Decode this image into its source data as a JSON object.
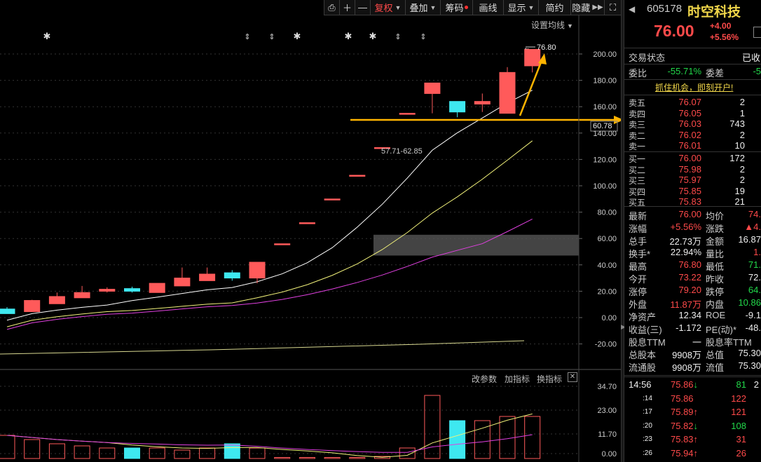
{
  "toolbar": {
    "fuquan": "复权",
    "diejia": "叠加",
    "chouma": "筹码",
    "huaxian": "画线",
    "xianshi": "显示",
    "jianyue": "简约",
    "yincang": "隐藏"
  },
  "chart": {
    "ma_settings": "设置均线",
    "price_ticks": [
      "200.00",
      "180.00",
      "160.00",
      "140.00",
      "120.00",
      "100.00",
      "80.00",
      "60.00",
      "40.00",
      "20.00",
      "0.00",
      "-20.00"
    ],
    "current_price_tag": "60.78",
    "high_annotation": "76.80",
    "gap_annotation": "57.71-62.85",
    "volume_ticks": [
      "34.70",
      "23.00",
      "11.70",
      "0.00"
    ],
    "volume_menu": {
      "change_params": "改参数",
      "add_indicator": "加指标",
      "switch_indicator": "换指标",
      "close": "✕"
    },
    "colors": {
      "up": "#ff5a5a",
      "down": "#3ee8f0",
      "ma1": "#ffffff",
      "ma2": "#f2f27a",
      "ma3": "#e040e0",
      "ma4": "#d8d890",
      "arrow": "#ffb400"
    }
  },
  "chart_data": {
    "type": "candlestick",
    "y_axis_range": [
      -20,
      200
    ],
    "candles": [
      {
        "open": 6.5,
        "high": 8.0,
        "low": 3.0,
        "close": 3.0,
        "dir": "down"
      },
      {
        "open": 4.5,
        "high": 13.5,
        "low": 4.5,
        "close": 13.0,
        "dir": "up"
      },
      {
        "open": 10.5,
        "high": 19.0,
        "low": 10.5,
        "close": 16.0,
        "dir": "up"
      },
      {
        "open": 15.0,
        "high": 24.0,
        "low": 15.0,
        "close": 19.0,
        "dir": "up"
      },
      {
        "open": 20.0,
        "high": 23.0,
        "low": 19.0,
        "close": 21.5,
        "dir": "up"
      },
      {
        "open": 22.0,
        "high": 23.5,
        "low": 19.0,
        "close": 20.0,
        "dir": "down"
      },
      {
        "open": 19.0,
        "high": 26.0,
        "low": 19.0,
        "close": 26.0,
        "dir": "up"
      },
      {
        "open": 24.0,
        "high": 38.0,
        "low": 24.0,
        "close": 30.0,
        "dir": "up"
      },
      {
        "open": 28.0,
        "high": 38.0,
        "low": 28.0,
        "close": 33.0,
        "dir": "up"
      },
      {
        "open": 34.0,
        "high": 36.0,
        "low": 28.0,
        "close": 30.0,
        "dir": "down"
      },
      {
        "open": 30.0,
        "high": 42.0,
        "low": 26.0,
        "close": 42.0,
        "dir": "up"
      },
      {
        "open": 56.0,
        "high": 56.0,
        "low": 56.0,
        "close": 56.0,
        "dir": "up"
      },
      {
        "open": 72.0,
        "high": 72.0,
        "low": 72.0,
        "close": 72.0,
        "dir": "up"
      },
      {
        "open": 90.0,
        "high": 90.0,
        "low": 90.0,
        "close": 90.0,
        "dir": "up"
      },
      {
        "open": 108.0,
        "high": 108.0,
        "low": 108.0,
        "close": 108.0,
        "dir": "up"
      },
      {
        "open": 129.0,
        "high": 129.0,
        "low": 129.0,
        "close": 129.0,
        "dir": "up"
      },
      {
        "open": 155.0,
        "high": 155.0,
        "low": 155.0,
        "close": 155.0,
        "dir": "up"
      },
      {
        "open": 170.0,
        "high": 178.0,
        "low": 155.0,
        "close": 178.0,
        "dir": "up"
      },
      {
        "open": 164.0,
        "high": 164.0,
        "low": 152.0,
        "close": 156.0,
        "dir": "down"
      },
      {
        "open": 162.0,
        "high": 170.0,
        "low": 156.0,
        "close": 164.0,
        "dir": "up"
      },
      {
        "open": 155.0,
        "high": 190.0,
        "low": 155.0,
        "close": 186.0,
        "dir": "up"
      },
      {
        "open": 191.0,
        "high": 203.5,
        "low": 186.0,
        "close": 203.5,
        "dir": "up"
      }
    ],
    "volume": [
      {
        "v": 11.0,
        "dir": "up"
      },
      {
        "v": 9.0,
        "dir": "up"
      },
      {
        "v": 7.0,
        "dir": "up"
      },
      {
        "v": 6.0,
        "dir": "up"
      },
      {
        "v": 5.0,
        "dir": "up"
      },
      {
        "v": 5.0,
        "dir": "down"
      },
      {
        "v": 5.0,
        "dir": "up"
      },
      {
        "v": 4.0,
        "dir": "up"
      },
      {
        "v": 5.0,
        "dir": "up"
      },
      {
        "v": 7.0,
        "dir": "down"
      },
      {
        "v": 5.0,
        "dir": "up"
      },
      {
        "v": 0.5,
        "dir": "up"
      },
      {
        "v": 0.5,
        "dir": "up"
      },
      {
        "v": 0.5,
        "dir": "up"
      },
      {
        "v": 0.5,
        "dir": "up"
      },
      {
        "v": 1.0,
        "dir": "up"
      },
      {
        "v": 5.0,
        "dir": "up"
      },
      {
        "v": 30.0,
        "dir": "up"
      },
      {
        "v": 18.0,
        "dir": "down"
      },
      {
        "v": 18.0,
        "dir": "up"
      },
      {
        "v": 20.0,
        "dir": "up"
      },
      {
        "v": 20.0,
        "dir": "up"
      }
    ]
  },
  "stock": {
    "code": "605178",
    "name": "时空科技",
    "price": "76.00",
    "change": "+4.00",
    "change_pct": "+5.56%",
    "trade_status_label": "交易状态",
    "trade_status_value": "已收",
    "weibi_label": "委比",
    "weibi_value": "-55.71%",
    "weicha_label": "委差",
    "weicha_value": "-5",
    "promo": "抓住机会，即刻开户!"
  },
  "order_book": {
    "asks": [
      {
        "label": "卖五",
        "price": "76.07",
        "vol": "2"
      },
      {
        "label": "卖四",
        "price": "76.05",
        "vol": "1"
      },
      {
        "label": "卖三",
        "price": "76.03",
        "vol": "743"
      },
      {
        "label": "卖二",
        "price": "76.02",
        "vol": "2"
      },
      {
        "label": "卖一",
        "price": "76.01",
        "vol": "10"
      }
    ],
    "bids": [
      {
        "label": "买一",
        "price": "76.00",
        "vol": "172"
      },
      {
        "label": "买二",
        "price": "75.98",
        "vol": "2"
      },
      {
        "label": "买三",
        "price": "75.97",
        "vol": "2"
      },
      {
        "label": "买四",
        "price": "75.85",
        "vol": "19"
      },
      {
        "label": "买五",
        "price": "75.83",
        "vol": "21"
      }
    ]
  },
  "stats": [
    {
      "l1": "最新",
      "v1": "76.00",
      "c1": "red",
      "l2": "均价",
      "v2": "74.",
      "c2": "red"
    },
    {
      "l1": "涨幅",
      "v1": "+5.56%",
      "c1": "red",
      "l2": "涨跌",
      "v2": "▲4.",
      "c2": "red"
    },
    {
      "l1": "总手",
      "v1": "22.73万",
      "c1": "white",
      "l2": "金额",
      "v2": "16.87",
      "c2": "white"
    },
    {
      "l1": "换手*",
      "v1": "22.94%",
      "c1": "white",
      "l2": "量比",
      "v2": "1.",
      "c2": "red"
    },
    {
      "l1": "最高",
      "v1": "76.80",
      "c1": "red",
      "l2": "最低",
      "v2": "71.",
      "c2": "green"
    },
    {
      "l1": "今开",
      "v1": "73.22",
      "c1": "red",
      "l2": "昨收",
      "v2": "72.",
      "c2": "white"
    },
    {
      "l1": "涨停",
      "v1": "79.20",
      "c1": "red",
      "l2": "跌停",
      "v2": "64.",
      "c2": "green"
    },
    {
      "l1": "外盘",
      "v1": "11.87万",
      "c1": "red",
      "l2": "内盘",
      "v2": "10.86",
      "c2": "green"
    },
    {
      "l1": "净资产",
      "v1": "12.34",
      "c1": "white",
      "l2": "ROE",
      "v2": "-9.1",
      "c2": "white"
    },
    {
      "l1": "收益(三)",
      "v1": "-1.172",
      "c1": "white",
      "l2": "PE(动)*",
      "v2": "-48.",
      "c2": "white"
    },
    {
      "l1": "股息TTM",
      "v1": "一",
      "c1": "white",
      "l2": "股息率TTM",
      "v2": "",
      "c2": "white"
    },
    {
      "l1": "总股本",
      "v1": "9908万",
      "c1": "white",
      "l2": "总值",
      "v2": "75.30",
      "c2": "white"
    },
    {
      "l1": "流通股",
      "v1": "9908万",
      "c1": "white",
      "l2": "流值",
      "v2": "75.30",
      "c2": "white"
    }
  ],
  "ticks": [
    {
      "time": "14:56",
      "price": "75.86",
      "dir": "down",
      "vol": "81",
      "extra": "2"
    },
    {
      "time": ":14",
      "price": "75.86",
      "dir": "",
      "vol": "122",
      "extra": ""
    },
    {
      "time": ":17",
      "price": "75.89",
      "dir": "up",
      "vol": "121",
      "extra": ""
    },
    {
      "time": ":20",
      "price": "75.82",
      "dir": "down",
      "vol": "108",
      "extra": ""
    },
    {
      "time": ":23",
      "price": "75.83",
      "dir": "up",
      "vol": "31",
      "extra": ""
    },
    {
      "time": ":26",
      "price": "75.94",
      "dir": "up",
      "vol": "26",
      "extra": ""
    }
  ]
}
